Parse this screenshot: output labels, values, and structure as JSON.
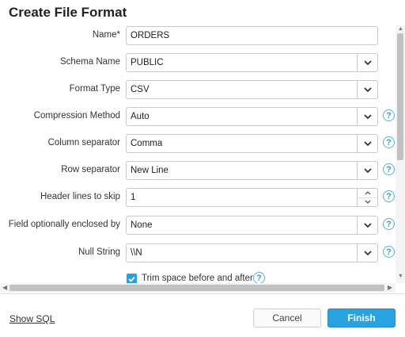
{
  "dialog": {
    "title": "Create File Format"
  },
  "form": {
    "name": {
      "label": "Name",
      "required_mark": "*",
      "value": "ORDERS"
    },
    "schema_name": {
      "label": "Schema Name",
      "value": "PUBLIC"
    },
    "format_type": {
      "label": "Format Type",
      "value": "CSV"
    },
    "compression_method": {
      "label": "Compression Method",
      "value": "Auto"
    },
    "column_separator": {
      "label": "Column separator",
      "value": "Comma"
    },
    "row_separator": {
      "label": "Row separator",
      "value": "New Line"
    },
    "header_lines": {
      "label": "Header lines to skip",
      "value": "1"
    },
    "field_enclosed": {
      "label": "Field optionally enclosed by",
      "value": "None"
    },
    "null_string": {
      "label": "Null String",
      "value": "\\\\N"
    },
    "trim_space": {
      "label": "Trim space before and after",
      "checked": true
    }
  },
  "help_glyph": "?",
  "icons": {
    "dropdown": "chevron-down-icon",
    "help": "help-icon",
    "check": "check-icon"
  },
  "footer": {
    "show_sql": "Show SQL",
    "cancel": "Cancel",
    "finish": "Finish"
  },
  "colors": {
    "accent": "#29a3e0",
    "help": "#3a9fd0"
  }
}
